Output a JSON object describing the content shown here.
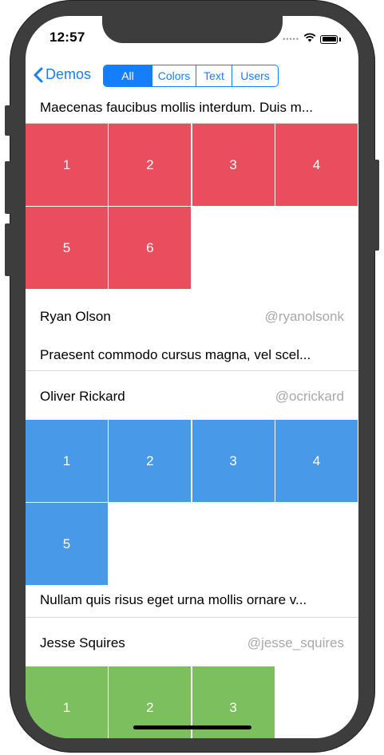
{
  "status": {
    "time": "12:57"
  },
  "nav": {
    "back_label": "Demos",
    "segments": [
      {
        "label": "All",
        "active": true
      },
      {
        "label": "Colors",
        "active": false
      },
      {
        "label": "Text",
        "active": false
      },
      {
        "label": "Users",
        "active": false
      }
    ]
  },
  "feed": [
    {
      "type": "text",
      "text": "Maecenas faucibus mollis interdum. Duis m..."
    },
    {
      "type": "colors",
      "color": "#e84e5e",
      "cells": [
        "1",
        "2",
        "3",
        "4",
        "5",
        "6"
      ]
    },
    {
      "type": "user",
      "name": "Ryan Olson",
      "handle": "@ryanolsonk"
    },
    {
      "type": "text",
      "text": "Praesent commodo cursus magna, vel scel..."
    },
    {
      "type": "user",
      "name": "Oliver Rickard",
      "handle": "@ocrickard"
    },
    {
      "type": "colors",
      "color": "#4899e8",
      "cells": [
        "1",
        "2",
        "3",
        "4",
        "5"
      ]
    },
    {
      "type": "text",
      "text": "Nullam quis risus eget urna mollis ornare v..."
    },
    {
      "type": "user",
      "name": "Jesse Squires",
      "handle": "@jesse_squires"
    },
    {
      "type": "colors",
      "color": "#7bbf5e",
      "cells": [
        "1",
        "2",
        "3"
      ]
    }
  ]
}
